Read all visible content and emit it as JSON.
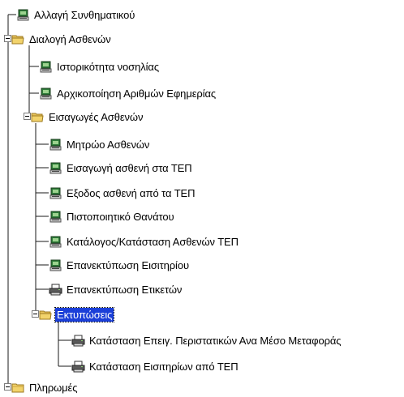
{
  "tree": {
    "items": [
      {
        "label": "Αλλαγή Συνθηματικού",
        "icon": "computer-icon"
      },
      {
        "label": "Διαλογή Ασθενών",
        "icon": "folder-open-icon",
        "expanded": true
      },
      {
        "label": "Ιστορικότητα νοσηλίας",
        "icon": "computer-icon"
      },
      {
        "label": "Αρχικοποίηση Αριθμών Εφημερίας",
        "icon": "computer-icon"
      },
      {
        "label": "Εισαγωγές Ασθενών",
        "icon": "folder-open-icon",
        "expanded": true
      },
      {
        "label": "Μητρώο Ασθενών",
        "icon": "computer-icon"
      },
      {
        "label": "Εισαγωγή ασθενή στα ΤΕΠ",
        "icon": "computer-icon"
      },
      {
        "label": "Εξοδος ασθενή από τα ΤΕΠ",
        "icon": "computer-icon"
      },
      {
        "label": "Πιστοποιητικό Θανάτου",
        "icon": "computer-icon"
      },
      {
        "label": "Κατάλογος/Κατάσταση Ασθενών ΤΕΠ",
        "icon": "computer-icon"
      },
      {
        "label": "Επανεκτύπωση Εισιτηρίου",
        "icon": "computer-icon"
      },
      {
        "label": "Επανεκτύπωση Ετικετών",
        "icon": "printer-icon"
      },
      {
        "label": "Εκτυπώσεις",
        "icon": "folder-open-icon",
        "expanded": true,
        "selected": true
      },
      {
        "label": "Κατάσταση Επειγ. Περιστατικών Ανα Μέσο Μεταφοράς",
        "icon": "printer-icon"
      },
      {
        "label": "Κατάσταση Εισιτηρίων από ΤΕΠ",
        "icon": "printer-icon"
      },
      {
        "label": "Πληρωμές",
        "icon": "folder-closed-icon",
        "expanded": false
      }
    ]
  },
  "colors": {
    "selection": "#1b3fd8",
    "folder": "#f2d36b",
    "computer": "#2f7d3a"
  }
}
